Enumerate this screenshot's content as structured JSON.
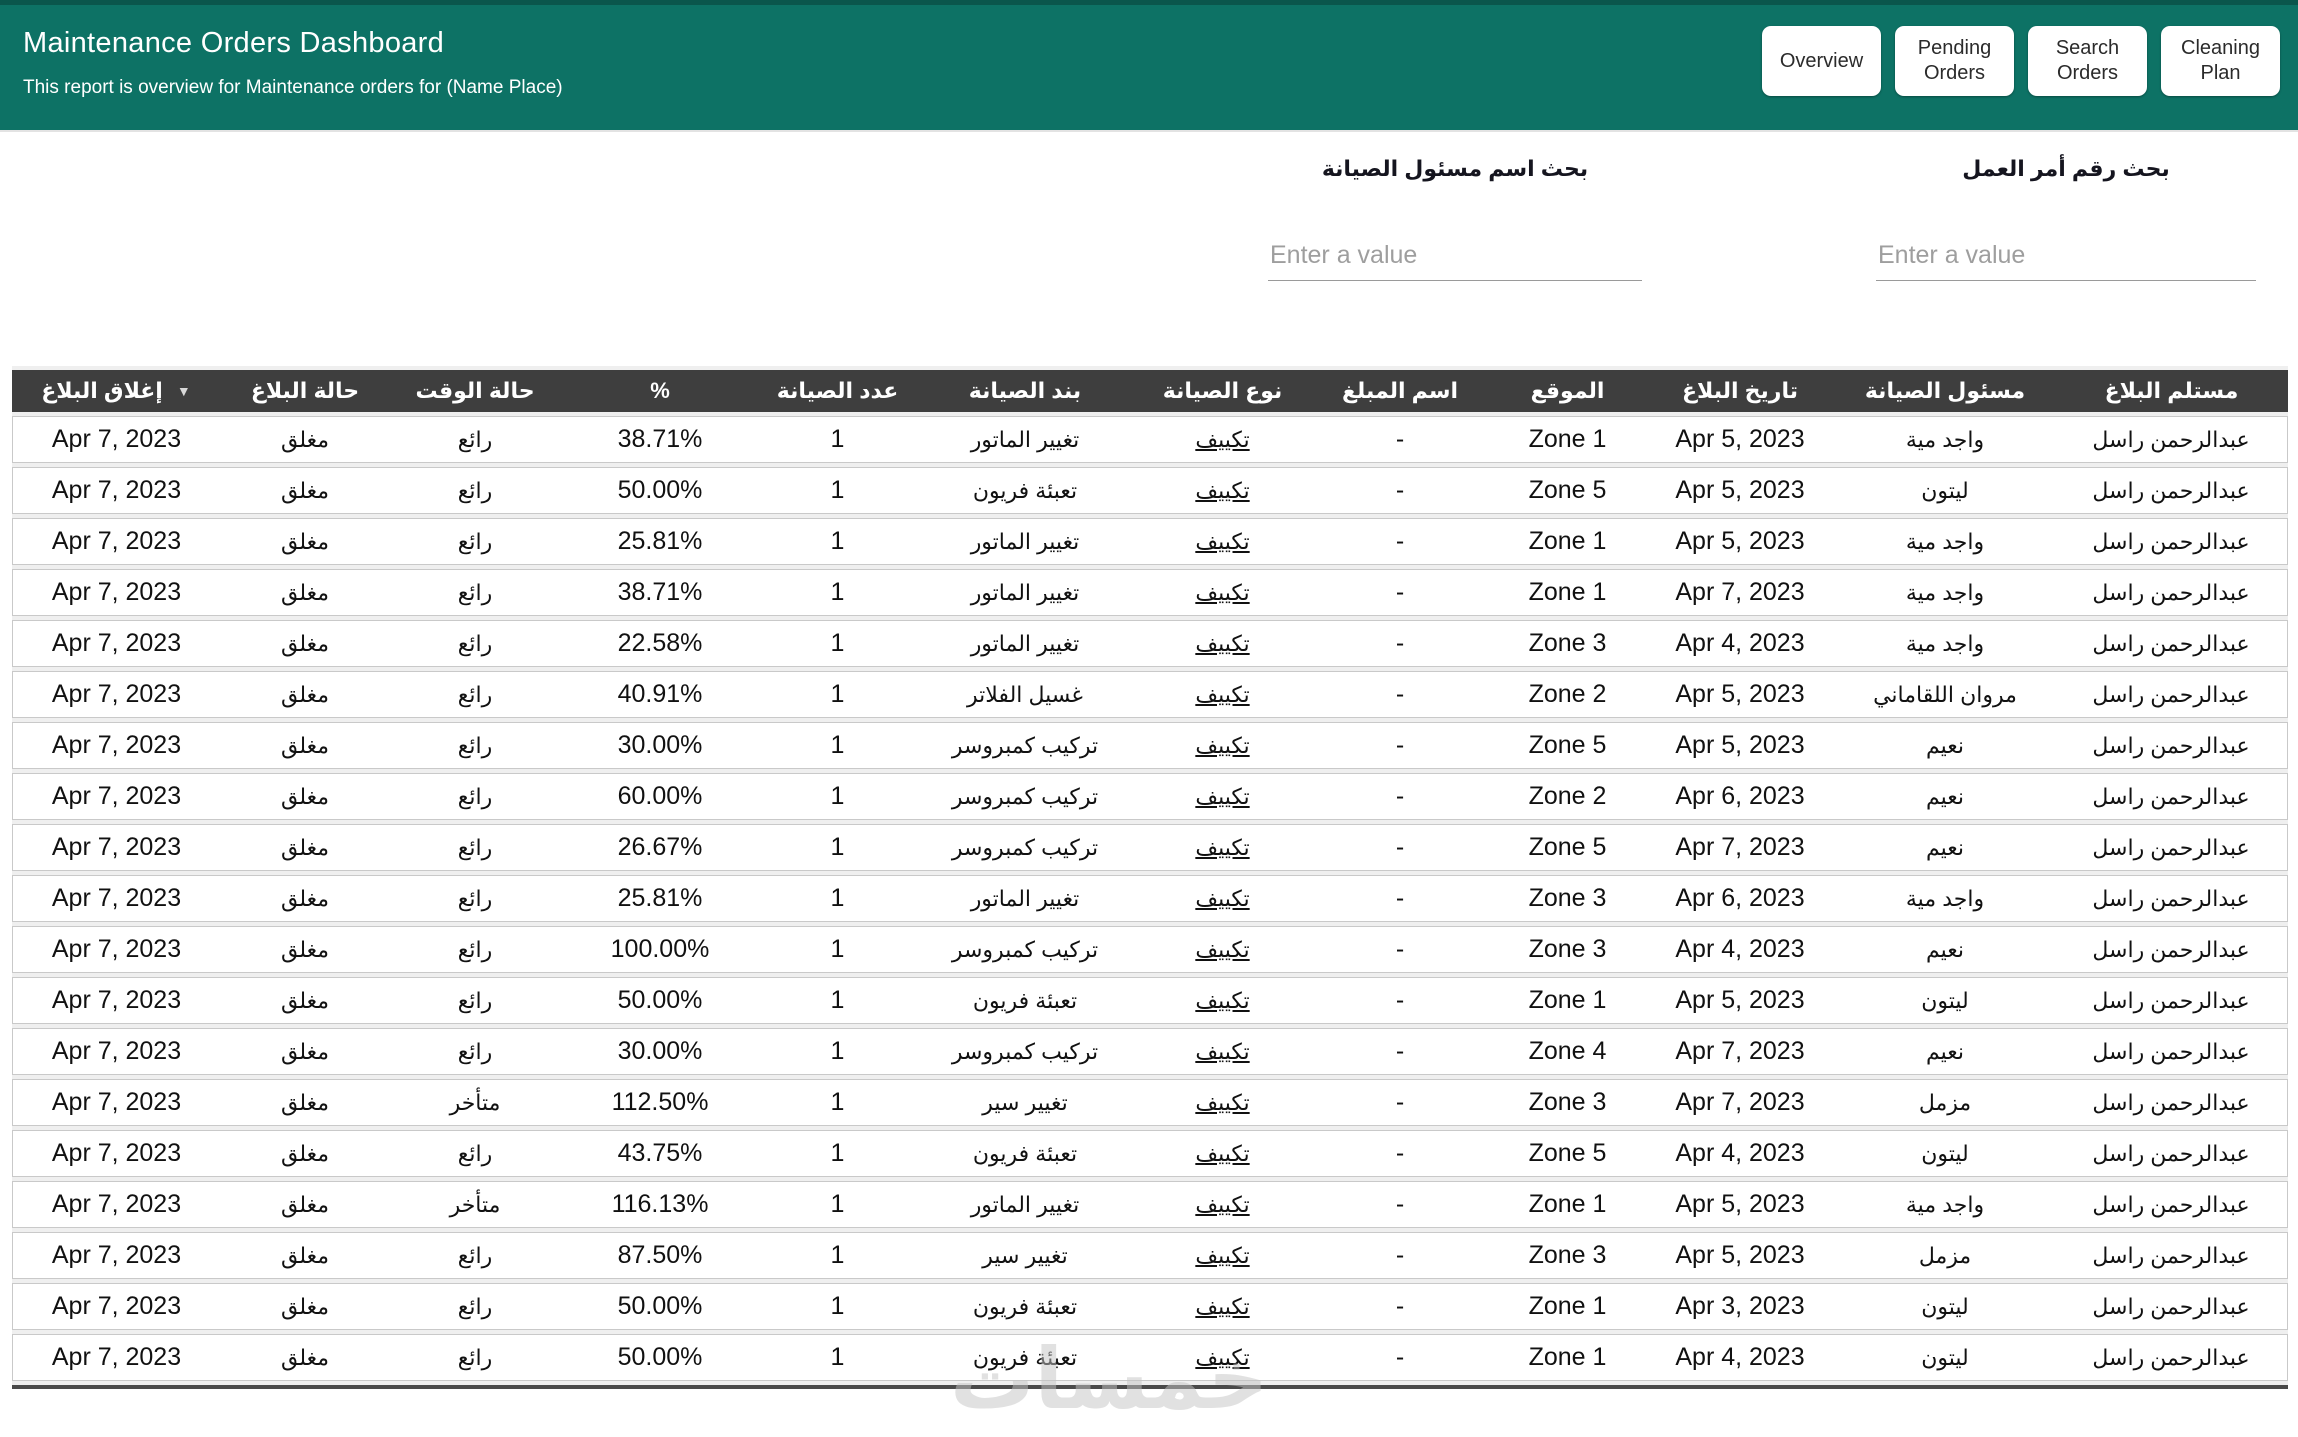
{
  "header": {
    "title": "Maintenance Orders Dashboard",
    "subtitle": "This report is overview for Maintenance orders for (Name Place)",
    "nav": {
      "overview": "Overview",
      "pending": "Pending Orders",
      "search": "Search Orders",
      "cleaning": "Cleaning Plan"
    }
  },
  "filters": {
    "supervisor": {
      "label": "بحث اسم مسئول الصيانة",
      "placeholder": "Enter a value",
      "value": ""
    },
    "work_order": {
      "label": "بحث رقم أمر العمل",
      "placeholder": "Enter a value",
      "value": ""
    }
  },
  "table": {
    "columns": [
      "إغلاق البلاغ",
      "حالة البلاغ",
      "حالة الوقت",
      "%",
      "عدد الصيانة",
      "بند الصيانة",
      "نوع الصيانة",
      "اسم المبلغ",
      "الموقع",
      "تاريخ البلاغ",
      "مسئول الصيانة",
      "مستلم البلاغ"
    ],
    "sort_icon": "▼",
    "rows": [
      [
        "Apr 7, 2023",
        "مغلق",
        "رائع",
        "38.71%",
        "1",
        "تغيير الماتور",
        "تكييف",
        "-",
        "Zone 1",
        "Apr 5, 2023",
        "واجد مية",
        "عبدالرحمن راسل"
      ],
      [
        "Apr 7, 2023",
        "مغلق",
        "رائع",
        "50.00%",
        "1",
        "تعبئة فريون",
        "تكييف",
        "-",
        "Zone 5",
        "Apr 5, 2023",
        "ليتون",
        "عبدالرحمن راسل"
      ],
      [
        "Apr 7, 2023",
        "مغلق",
        "رائع",
        "25.81%",
        "1",
        "تغيير الماتور",
        "تكييف",
        "-",
        "Zone 1",
        "Apr 5, 2023",
        "واجد مية",
        "عبدالرحمن راسل"
      ],
      [
        "Apr 7, 2023",
        "مغلق",
        "رائع",
        "38.71%",
        "1",
        "تغيير الماتور",
        "تكييف",
        "-",
        "Zone 1",
        "Apr 7, 2023",
        "واجد مية",
        "عبدالرحمن راسل"
      ],
      [
        "Apr 7, 2023",
        "مغلق",
        "رائع",
        "22.58%",
        "1",
        "تغيير الماتور",
        "تكييف",
        "-",
        "Zone 3",
        "Apr 4, 2023",
        "واجد مية",
        "عبدالرحمن راسل"
      ],
      [
        "Apr 7, 2023",
        "مغلق",
        "رائع",
        "40.91%",
        "1",
        "غسيل الفلاتر",
        "تكييف",
        "-",
        "Zone 2",
        "Apr 5, 2023",
        "مروان اللقاماني",
        "عبدالرحمن راسل"
      ],
      [
        "Apr 7, 2023",
        "مغلق",
        "رائع",
        "30.00%",
        "1",
        "تركيب كمبروسر",
        "تكييف",
        "-",
        "Zone 5",
        "Apr 5, 2023",
        "نعيم",
        "عبدالرحمن راسل"
      ],
      [
        "Apr 7, 2023",
        "مغلق",
        "رائع",
        "60.00%",
        "1",
        "تركيب كمبروسر",
        "تكييف",
        "-",
        "Zone 2",
        "Apr 6, 2023",
        "نعيم",
        "عبدالرحمن راسل"
      ],
      [
        "Apr 7, 2023",
        "مغلق",
        "رائع",
        "26.67%",
        "1",
        "تركيب كمبروسر",
        "تكييف",
        "-",
        "Zone 5",
        "Apr 7, 2023",
        "نعيم",
        "عبدالرحمن راسل"
      ],
      [
        "Apr 7, 2023",
        "مغلق",
        "رائع",
        "25.81%",
        "1",
        "تغيير الماتور",
        "تكييف",
        "-",
        "Zone 3",
        "Apr 6, 2023",
        "واجد مية",
        "عبدالرحمن راسل"
      ],
      [
        "Apr 7, 2023",
        "مغلق",
        "رائع",
        "100.00%",
        "1",
        "تركيب كمبروسر",
        "تكييف",
        "-",
        "Zone 3",
        "Apr 4, 2023",
        "نعيم",
        "عبدالرحمن راسل"
      ],
      [
        "Apr 7, 2023",
        "مغلق",
        "رائع",
        "50.00%",
        "1",
        "تعبئة فريون",
        "تكييف",
        "-",
        "Zone 1",
        "Apr 5, 2023",
        "ليتون",
        "عبدالرحمن راسل"
      ],
      [
        "Apr 7, 2023",
        "مغلق",
        "رائع",
        "30.00%",
        "1",
        "تركيب كمبروسر",
        "تكييف",
        "-",
        "Zone 4",
        "Apr 7, 2023",
        "نعيم",
        "عبدالرحمن راسل"
      ],
      [
        "Apr 7, 2023",
        "مغلق",
        "متأخر",
        "112.50%",
        "1",
        "تغيير سير",
        "تكييف",
        "-",
        "Zone 3",
        "Apr 7, 2023",
        "مزمل",
        "عبدالرحمن راسل"
      ],
      [
        "Apr 7, 2023",
        "مغلق",
        "رائع",
        "43.75%",
        "1",
        "تعبئة فريون",
        "تكييف",
        "-",
        "Zone 5",
        "Apr 4, 2023",
        "ليتون",
        "عبدالرحمن راسل"
      ],
      [
        "Apr 7, 2023",
        "مغلق",
        "متأخر",
        "116.13%",
        "1",
        "تغيير الماتور",
        "تكييف",
        "-",
        "Zone 1",
        "Apr 5, 2023",
        "واجد مية",
        "عبدالرحمن راسل"
      ],
      [
        "Apr 7, 2023",
        "مغلق",
        "رائع",
        "87.50%",
        "1",
        "تغيير سير",
        "تكييف",
        "-",
        "Zone 3",
        "Apr 5, 2023",
        "مزمل",
        "عبدالرحمن راسل"
      ],
      [
        "Apr 7, 2023",
        "مغلق",
        "رائع",
        "50.00%",
        "1",
        "تعبئة فريون",
        "تكييف",
        "-",
        "Zone 1",
        "Apr 3, 2023",
        "ليتون",
        "عبدالرحمن راسل"
      ],
      [
        "Apr 7, 2023",
        "مغلق",
        "رائع",
        "50.00%",
        "1",
        "تعبئة فريون",
        "تكييف",
        "-",
        "Zone 1",
        "Apr 4, 2023",
        "ليتون",
        "عبدالرحمن راسل"
      ]
    ]
  },
  "watermark": {
    "text": "خمسات"
  },
  "colors": {
    "header_bg": "#0d7265",
    "table_header_bg": "#3e3e3e",
    "button_bg": "#ffffff"
  }
}
